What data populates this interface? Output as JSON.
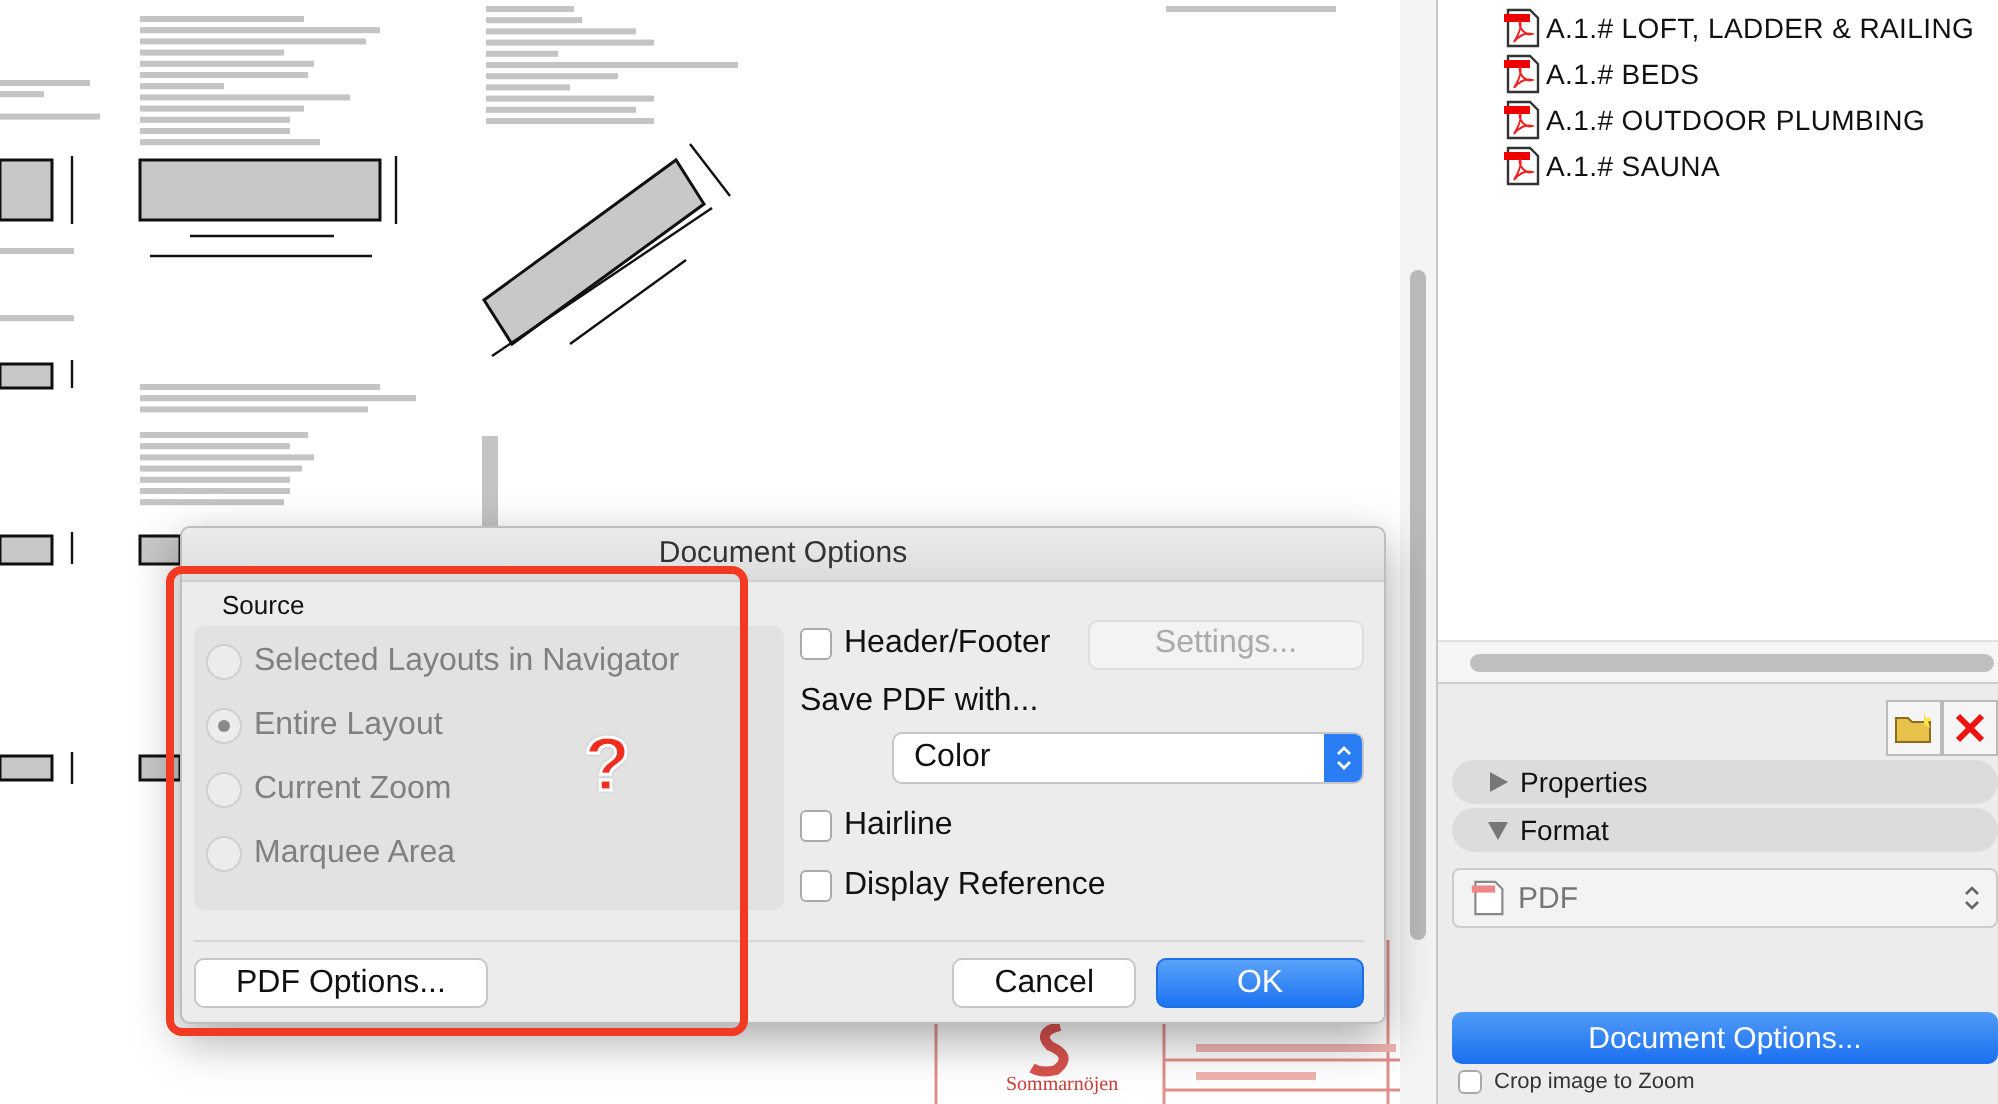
{
  "canvas": {
    "title_block_text": "Sommarnöjen"
  },
  "navigator": {
    "items": [
      {
        "label": "A.1.# LOFT, LADDER & RAILING"
      },
      {
        "label": "A.1.# BEDS"
      },
      {
        "label": "A.1.# OUTDOOR PLUMBING"
      },
      {
        "label": "A.1.# SAUNA"
      }
    ]
  },
  "panel": {
    "sections": [
      {
        "label": "Properties",
        "expanded": false
      },
      {
        "label": "Format",
        "expanded": true
      }
    ],
    "format_select": {
      "value": "PDF"
    },
    "primary_button": "Document Options...",
    "crop_option": {
      "label": "Crop image to Zoom",
      "checked": false
    }
  },
  "dialog": {
    "title": "Document Options",
    "source": {
      "label": "Source",
      "disabled": true,
      "options": [
        {
          "label": "Selected Layouts in Navigator",
          "selected": false
        },
        {
          "label": "Entire Layout",
          "selected": true
        },
        {
          "label": "Current Zoom",
          "selected": false
        },
        {
          "label": "Marquee Area",
          "selected": false
        }
      ]
    },
    "header_footer": {
      "label": "Header/Footer",
      "checked": false
    },
    "settings_button": {
      "label": "Settings...",
      "disabled": true
    },
    "save_with_label": "Save PDF with...",
    "save_with_select": {
      "value": "Color"
    },
    "checkboxes": [
      {
        "label": "Hairline",
        "checked": false
      },
      {
        "label": "Display Reference",
        "checked": false
      }
    ],
    "pdf_options_button": "PDF Options...",
    "cancel_button": "Cancel",
    "ok_button": "OK"
  },
  "annotation": {
    "mark": "?"
  }
}
